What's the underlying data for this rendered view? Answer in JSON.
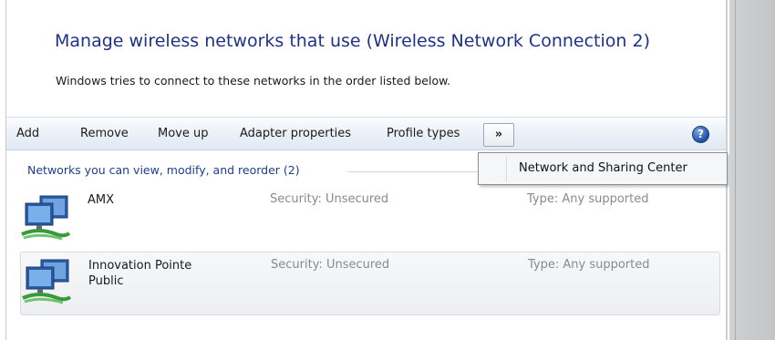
{
  "header": {
    "title": "Manage wireless networks that use (Wireless Network Connection 2)",
    "subtitle": "Windows tries to connect to these networks in the order listed below."
  },
  "toolbar": {
    "add": "Add",
    "remove": "Remove",
    "move_up": "Move up",
    "adapter_properties": "Adapter properties",
    "profile_types": "Profile types",
    "overflow": "»",
    "help": "?"
  },
  "overflow_menu": {
    "items": [
      "Network and Sharing Center"
    ]
  },
  "group": {
    "header": "Networks you can view, modify, and reorder (2)"
  },
  "networks": [
    {
      "name_line1": "AMX",
      "name_line2": "",
      "security": "Security: Unsecured",
      "type": "Type: Any supported",
      "selected": false
    },
    {
      "name_line1": "Innovation Pointe",
      "name_line2": "Public",
      "security": "Security: Unsecured",
      "type": "Type: Any supported",
      "selected": true
    }
  ],
  "icons": {
    "network": "wireless-network-icon",
    "help": "help-icon"
  }
}
